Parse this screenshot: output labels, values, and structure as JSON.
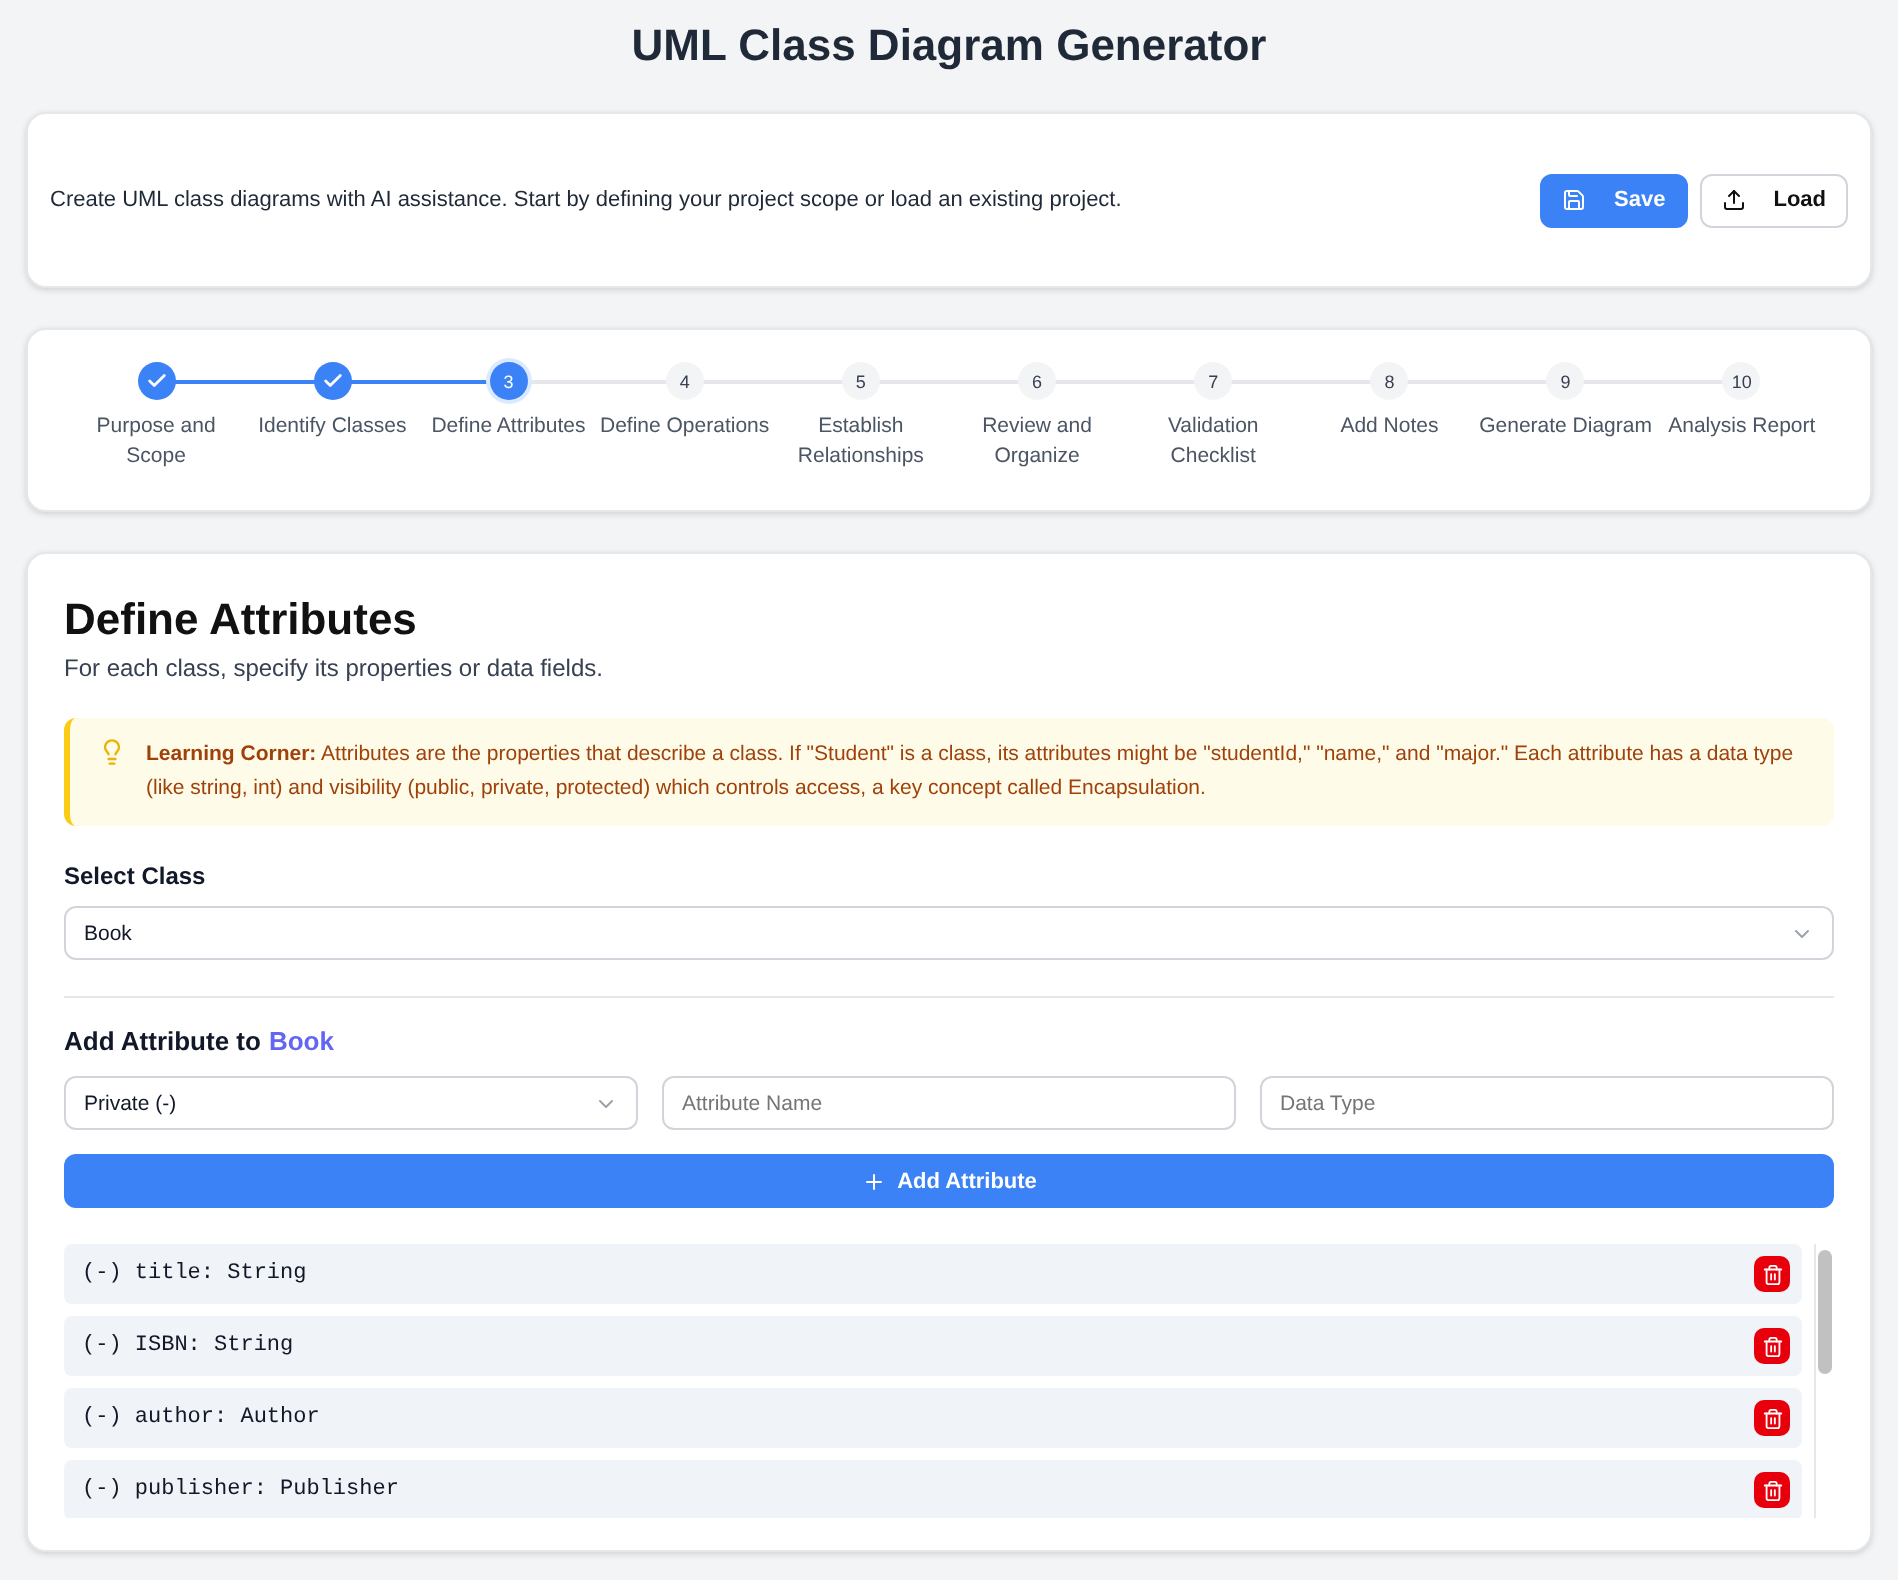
{
  "title": "UML Class Diagram Generator",
  "intro": {
    "text": "Create UML class diagrams with AI assistance. Start by defining your project scope or load an existing project.",
    "buttons": [
      {
        "label": "Save",
        "kind": "primary"
      },
      {
        "label": "Load",
        "kind": "secondary"
      }
    ]
  },
  "steps": [
    {
      "label": "Purpose and Scope",
      "completed": true,
      "selected": false
    },
    {
      "label": "Identify Classes",
      "completed": true,
      "selected": false
    },
    {
      "number": "3",
      "label": "Define Attributes",
      "completed": false,
      "selected": true
    },
    {
      "number": "4",
      "label": "Define Operations",
      "completed": false,
      "selected": false
    },
    {
      "number": "5",
      "label": "Establish Relationships",
      "completed": false,
      "selected": false
    },
    {
      "number": "6",
      "label": "Review and Organize",
      "completed": false,
      "selected": false
    },
    {
      "number": "7",
      "label": "Validation Checklist",
      "completed": false,
      "selected": false
    },
    {
      "number": "8",
      "label": "Add Notes",
      "completed": false,
      "selected": false
    },
    {
      "number": "9",
      "label": "Generate Diagram",
      "completed": false,
      "selected": false
    },
    {
      "number": "10",
      "label": "Analysis Report",
      "completed": false,
      "selected": false
    }
  ],
  "section": {
    "heading": "Define Attributes",
    "subtitle": "For each class, specify its properties or data fields.",
    "tip": "**Learning Corner:** Attributes are the properties that describe a class. If \"Student\" is a class, its attributes might be \"studentId,\" \"name,\" and \"major.\" Each attribute has a data type (like string, int) and visibility (public, private, protected) which controls access, a key concept called Encapsulation.",
    "select_label": "Select Class",
    "selected_class": "Book",
    "add_heading": "Add Attribute to",
    "add_class": "Book",
    "visibility": "Private (-)",
    "name_placeholder": "Attribute Name",
    "type_placeholder": "Data Type",
    "add_button": "Add Attribute",
    "attributes": [
      "(-) title: String",
      "(-) ISBN: String",
      "(-) author: Author",
      "(-) publisher: Publisher"
    ]
  }
}
